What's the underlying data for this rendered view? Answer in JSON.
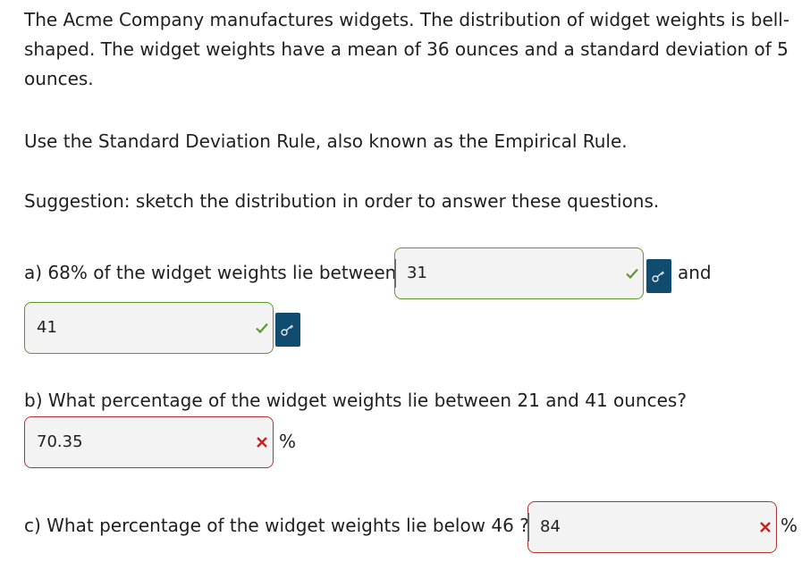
{
  "intro": "The Acme Company manufactures widgets. The distribution of widget weights is bell-shaped. The widget weights have a mean of 36 ounces and a standard deviation of 5 ounces.",
  "rule": "Use the Standard Deviation Rule, also known as the Empirical Rule.",
  "suggestion": "Suggestion: sketch the distribution in order to answer these questions.",
  "part_a": {
    "prompt": "a) 68% of the widget weights lie between",
    "answer1": "31",
    "connector": "and",
    "answer2": "41",
    "status": "correct"
  },
  "part_b": {
    "prompt": "b) What percentage of the widget weights lie between 21 and 41 ounces?",
    "answer": "70.35",
    "unit": "%",
    "status": "incorrect"
  },
  "part_c": {
    "prompt": "c) What percentage of the widget weights lie below 46 ?",
    "answer": "84",
    "unit": "%",
    "status": "incorrect"
  },
  "icons": {
    "correct": "check-icon",
    "incorrect": "x-icon",
    "show_answer": "key-icon"
  },
  "colors": {
    "correct": "#5a9a2e",
    "incorrect": "#b13434",
    "key_button": "#0f4c6f"
  }
}
